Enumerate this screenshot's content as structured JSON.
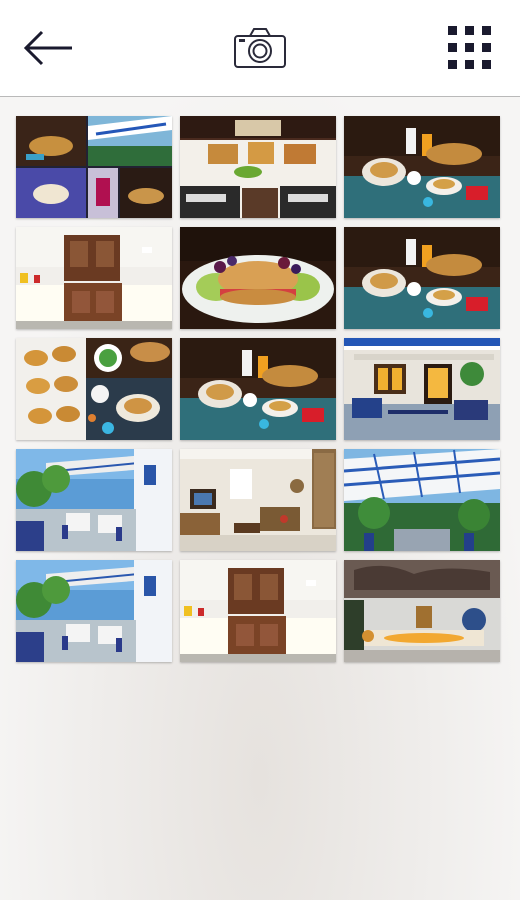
{
  "screen": "photo-gallery",
  "toolbar": {
    "back_icon": "arrow-left-icon",
    "camera_icon": "camera-icon",
    "grid_icon": "grid-icon",
    "icon_color": "#1a1a2e"
  },
  "gallery": {
    "columns": 3,
    "photos": [
      {
        "name": "photo-breakfast-collage",
        "scene": "collage"
      },
      {
        "name": "photo-breakfast-table-overhead",
        "scene": "table-overhead"
      },
      {
        "name": "photo-breakfast-spread-1",
        "scene": "breakfast-spread"
      },
      {
        "name": "photo-breakfast-buffet-room",
        "scene": "buffet-room"
      },
      {
        "name": "photo-croissant-sandwich",
        "scene": "sandwich"
      },
      {
        "name": "photo-breakfast-spread-2",
        "scene": "breakfast-spread"
      },
      {
        "name": "photo-pastries-coffee",
        "scene": "pastries"
      },
      {
        "name": "photo-breakfast-spread-3",
        "scene": "breakfast-spread"
      },
      {
        "name": "photo-blue-lounge",
        "scene": "lounge"
      },
      {
        "name": "photo-terrace-garden-1",
        "scene": "terrace"
      },
      {
        "name": "photo-living-room",
        "scene": "living-room"
      },
      {
        "name": "photo-pergola-patio",
        "scene": "pergola"
      },
      {
        "name": "photo-terrace-garden-2",
        "scene": "terrace"
      },
      {
        "name": "photo-breakfast-buffet-room-2",
        "scene": "buffet-room"
      },
      {
        "name": "photo-cave-bar",
        "scene": "cave-bar"
      }
    ]
  }
}
